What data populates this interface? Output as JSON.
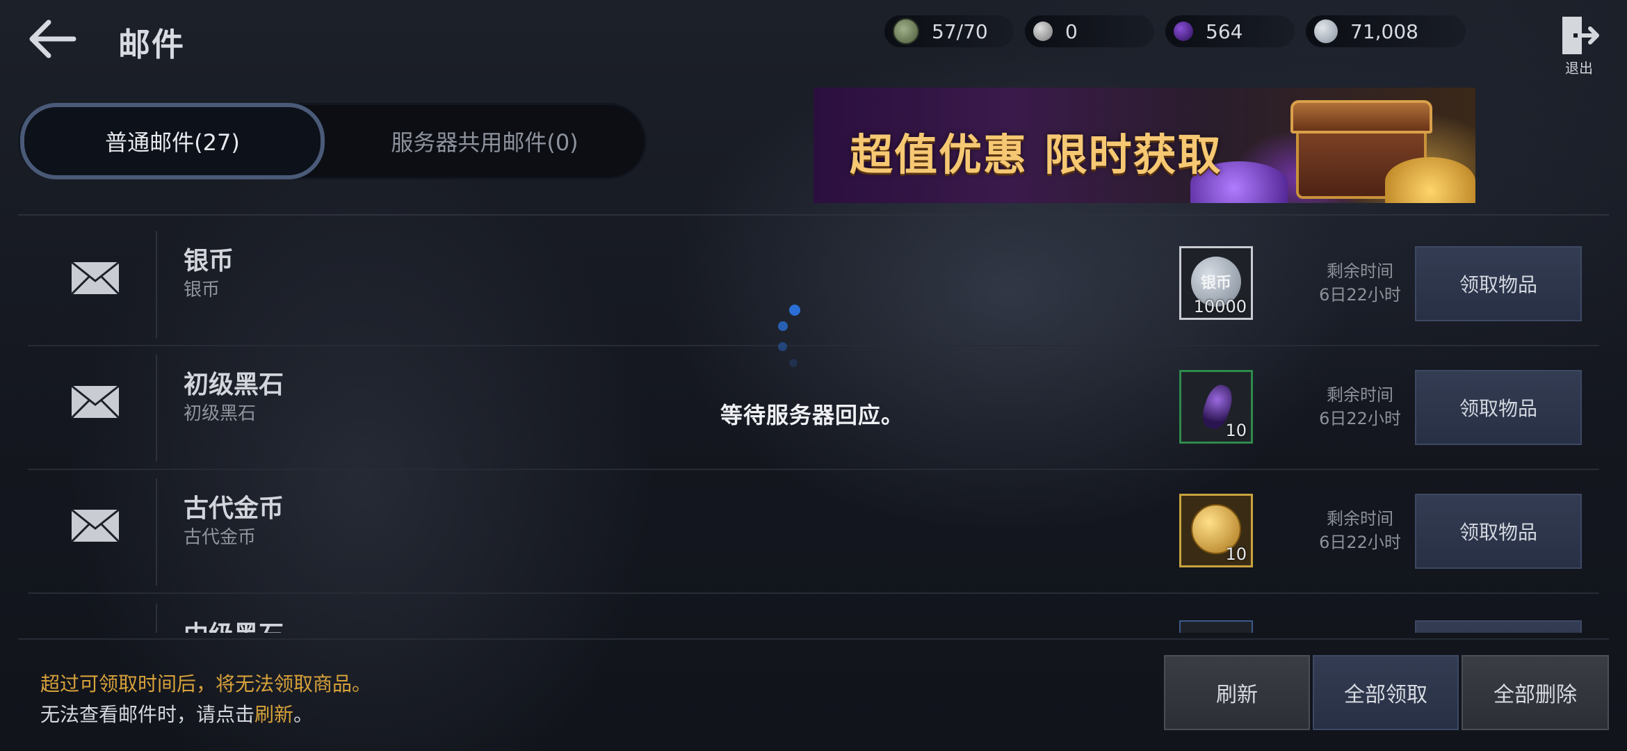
{
  "header": {
    "title": "邮件",
    "exit_label": "退出",
    "resources": [
      {
        "icon": "energy-icon",
        "value": "57/70"
      },
      {
        "icon": "silver-orb-icon",
        "value": "0"
      },
      {
        "icon": "purple-gem-icon",
        "value": "564"
      },
      {
        "icon": "silver-coin-icon",
        "value": "71,008"
      }
    ]
  },
  "tabs": [
    {
      "label": "普通邮件(27)",
      "active": true
    },
    {
      "label": "服务器共用邮件(0)",
      "active": false
    }
  ],
  "banner": {
    "text": "超值优惠 限时获取"
  },
  "mails": [
    {
      "title": "银币",
      "subtitle": "银币",
      "item_icon": "silver-coin-item-icon",
      "item_label": "银币",
      "item_count": "10000",
      "time_label": "剩余时间",
      "time_value": "6日22小时",
      "claim_label": "领取物品",
      "border": "#c9ccd2"
    },
    {
      "title": "初级黑石",
      "subtitle": "初级黑石",
      "item_icon": "black-stone-item-icon",
      "item_count": "10",
      "time_label": "剩余时间",
      "time_value": "6日22小时",
      "claim_label": "领取物品",
      "border": "#2e8a4c"
    },
    {
      "title": "古代金币",
      "subtitle": "古代金币",
      "item_icon": "ancient-gold-coin-item-icon",
      "item_count": "10",
      "time_label": "剩余时间",
      "time_value": "6日22小时",
      "claim_label": "领取物品",
      "border": "#c9a33f"
    },
    {
      "title": "中级黑石"
    }
  ],
  "loading": {
    "text": "等待服务器回应。"
  },
  "footer": {
    "notice_line1": "超过可领取时间后，将无法领取商品。",
    "notice_line2_prefix": "无法查看邮件时，请点击",
    "notice_line2_link": "刷新",
    "notice_line2_suffix": "。",
    "refresh_label": "刷新",
    "claim_all_label": "全部领取",
    "delete_all_label": "全部删除"
  },
  "colors": {
    "accent_gold": "#d8a23a",
    "tab_border": "#4a5a78",
    "spinner": "#2b6fd6"
  }
}
